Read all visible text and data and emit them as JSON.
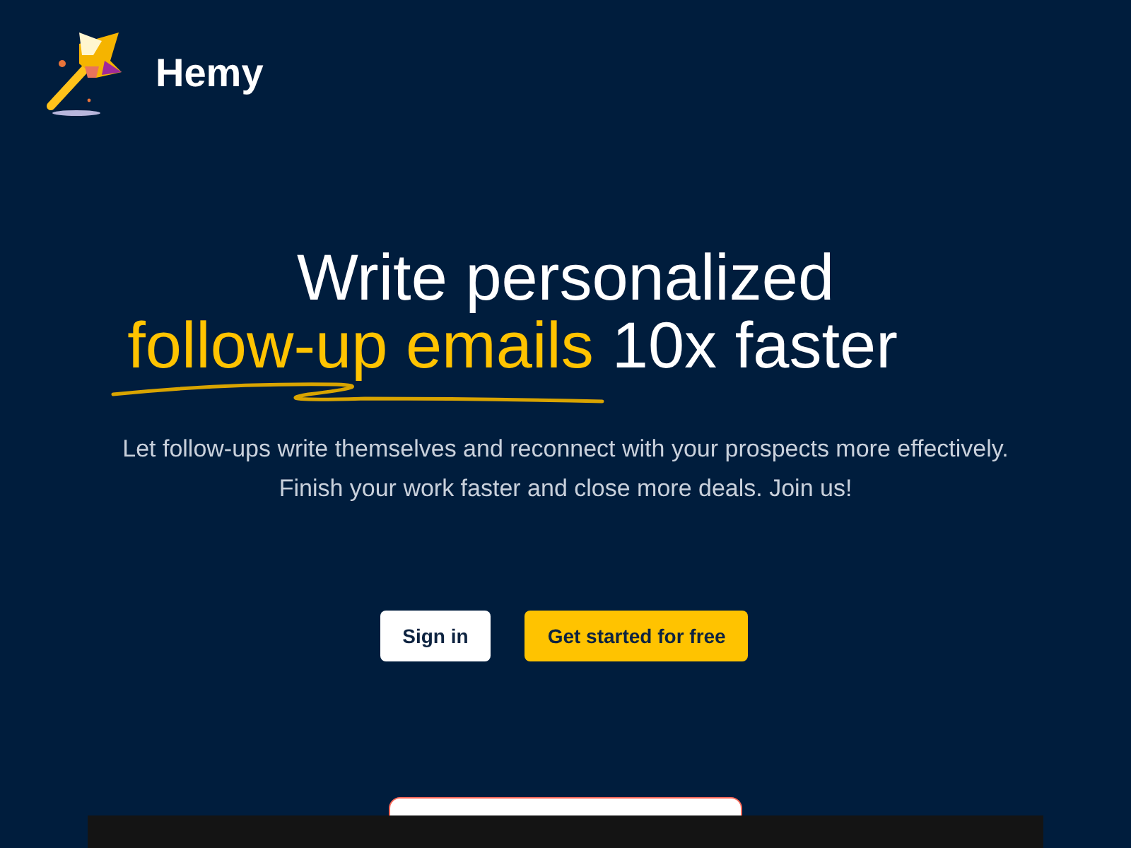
{
  "brand": {
    "name": "Hemy"
  },
  "hero": {
    "title_line_1": "Write personalized",
    "highlight": "follow-up emails",
    "title_rest": "10x faster",
    "subtitle_lines": [
      "Let follow-ups write themselves and reconnect with your prospects more effectively.",
      "Finish your work faster and close more deals. Join us!"
    ]
  },
  "buttons": [
    {
      "label": "Sign in",
      "kind": "secondary"
    },
    {
      "label": "Get started for free",
      "kind": "primary"
    }
  ]
}
